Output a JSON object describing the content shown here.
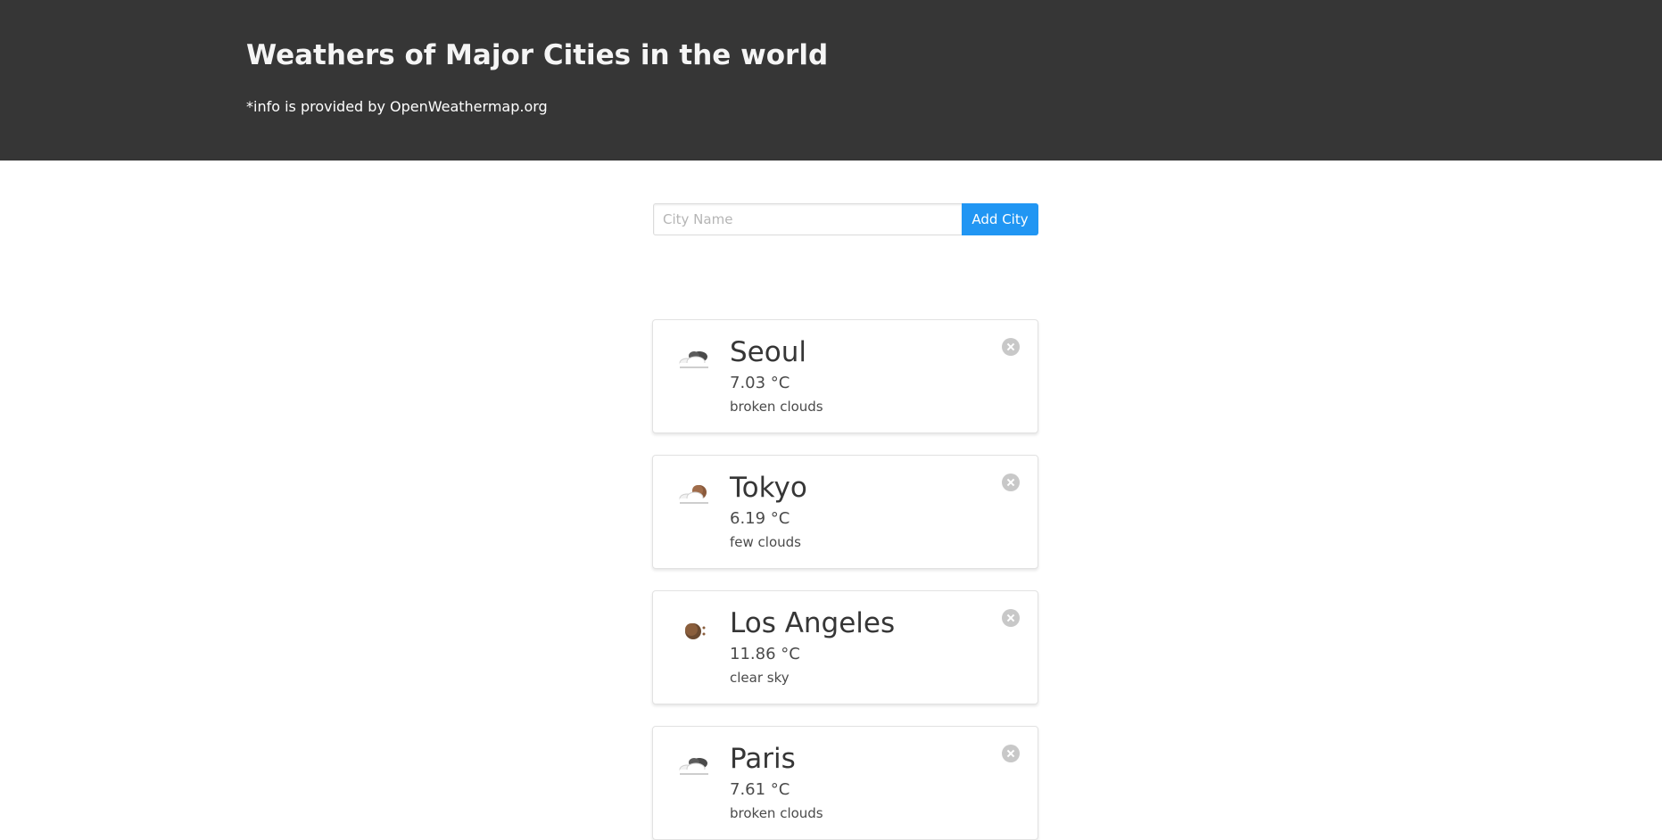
{
  "header": {
    "title": "Weathers of Major Cities in the world",
    "subtitle": "*info is provided by OpenWeathermap.org"
  },
  "form": {
    "placeholder": "City Name",
    "value": "",
    "button_label": "Add City"
  },
  "colors": {
    "header_bg": "#363636",
    "accent": "#2196f3",
    "delete": "#c8c8c8"
  },
  "cities": [
    {
      "name": "Seoul",
      "temp": "7.03 °C",
      "description": "broken clouds",
      "icon": "broken-clouds-icon"
    },
    {
      "name": "Tokyo",
      "temp": "6.19 °C",
      "description": "few clouds",
      "icon": "few-clouds-night-icon"
    },
    {
      "name": "Los Angeles",
      "temp": "11.86 °C",
      "description": "clear sky",
      "icon": "clear-sky-night-icon"
    },
    {
      "name": "Paris",
      "temp": "7.61 °C",
      "description": "broken clouds",
      "icon": "broken-clouds-icon"
    }
  ]
}
